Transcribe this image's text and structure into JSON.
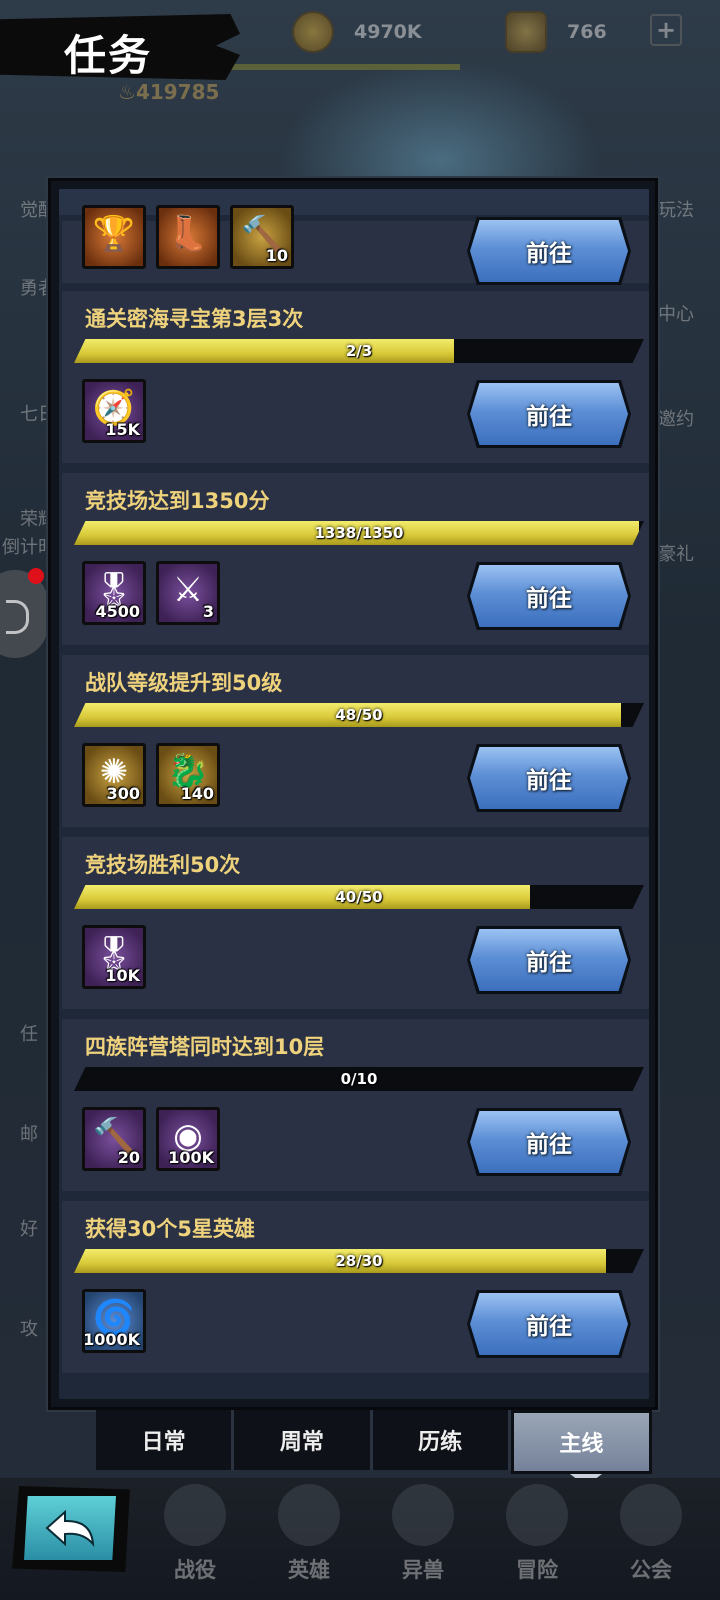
{
  "header": {
    "title": "任务",
    "gold": "4970K",
    "gems": "766",
    "power": "419785"
  },
  "side_labels_left": [
    "觉醒",
    "勇者",
    "七日",
    "荣耀",
    "倒计时",
    "任",
    "邮",
    "好",
    "攻"
  ],
  "side_labels_right": [
    "玩法",
    "中心",
    "邀约",
    "豪礼"
  ],
  "partial_card": {
    "rewards": [
      {
        "icon": "trophy-icon",
        "qty": "",
        "bg": "orange"
      },
      {
        "icon": "boot-icon",
        "qty": "",
        "bg": "orange"
      },
      {
        "icon": "hammer-icon",
        "qty": "10",
        "bg": "gold"
      }
    ],
    "button": "前往"
  },
  "tasks": [
    {
      "title": "通关密海寻宝第3层3次",
      "progress": "2/3",
      "ratio": 0.667,
      "button": "前往",
      "rewards": [
        {
          "icon": "compass-icon",
          "qty": "15K",
          "bg": "purple"
        }
      ]
    },
    {
      "title": "竞技场达到1350分",
      "progress": "1338/1350",
      "ratio": 0.991,
      "button": "前往",
      "rewards": [
        {
          "icon": "medal-icon",
          "qty": "4500",
          "bg": "purple"
        },
        {
          "icon": "sword-token-icon",
          "qty": "3",
          "bg": "purple"
        }
      ]
    },
    {
      "title": "战队等级提升到50级",
      "progress": "48/50",
      "ratio": 0.96,
      "button": "前往",
      "rewards": [
        {
          "icon": "gem-pile-icon",
          "qty": "300",
          "bg": "gold"
        },
        {
          "icon": "dragon-icon",
          "qty": "140",
          "bg": "gold"
        }
      ]
    },
    {
      "title": "竞技场胜利50次",
      "progress": "40/50",
      "ratio": 0.8,
      "button": "前往",
      "rewards": [
        {
          "icon": "medal-icon",
          "qty": "10K",
          "bg": "purple"
        }
      ]
    },
    {
      "title": "四族阵营塔同时达到10层",
      "progress": "0/10",
      "ratio": 0,
      "button": "前往",
      "rewards": [
        {
          "icon": "hammer-icon",
          "qty": "20",
          "bg": "purple"
        },
        {
          "icon": "gold-coin-icon",
          "qty": "100K",
          "bg": "purple"
        }
      ]
    },
    {
      "title": "获得30个5星英雄",
      "progress": "28/30",
      "ratio": 0.933,
      "button": "前往",
      "rewards": [
        {
          "icon": "swirl-orb-icon",
          "qty": "1000K",
          "bg": "blue"
        }
      ]
    }
  ],
  "tabs": [
    {
      "label": "日常",
      "active": false
    },
    {
      "label": "周常",
      "active": false
    },
    {
      "label": "历练",
      "active": false
    },
    {
      "label": "主线",
      "active": true
    }
  ],
  "bottom_nav": [
    "战役",
    "英雄",
    "异兽",
    "冒险",
    "公会"
  ]
}
